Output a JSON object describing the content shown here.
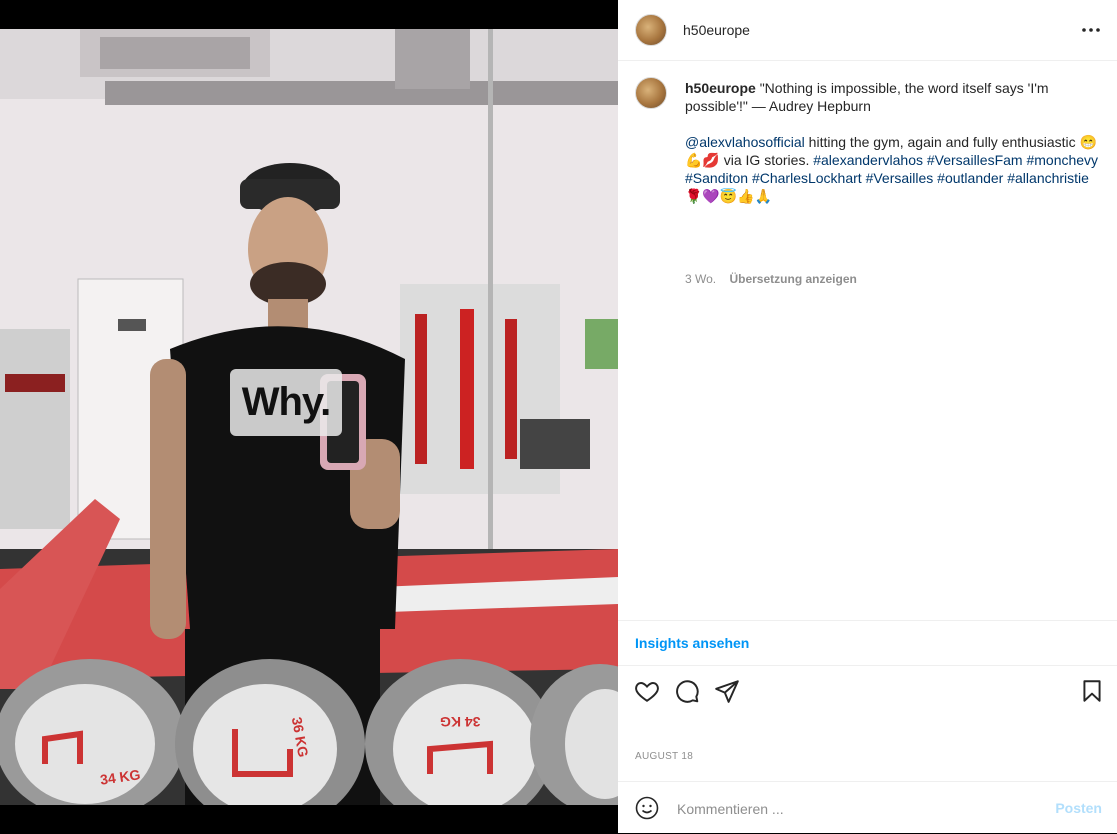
{
  "post": {
    "username": "h50europe",
    "caption_quote": "\"Nothing is impossible, the word itself says 'I'm possible'!\" — Audrey Hepburn",
    "mention": "@alexvlahosofficial",
    "caption_text": " hitting the gym, again and fully enthusiastic 😁💪💋 via IG stories. ",
    "hashtags": [
      "#alexandervlahos",
      "#VersaillesFam",
      "#monchevy",
      "#Sanditon",
      "#CharlesLockhart",
      "#Versailles",
      "#outlander",
      "#allanchristie"
    ],
    "caption_end_emojis": "🌹💜😇👍🙏",
    "age": "3 Wo.",
    "translate_label": "Übersetzung anzeigen",
    "insights_label": "Insights ansehen",
    "date": "AUGUST 18",
    "comment_placeholder": "Kommentieren ...",
    "post_label": "Posten"
  },
  "photo": {
    "sticker_text": "Why.",
    "plate_labels": [
      "34 KG",
      "36 KG",
      "34 KG"
    ]
  },
  "icons": {
    "more": "more-options-icon",
    "like": "heart-icon",
    "comment": "comment-icon",
    "share": "share-icon",
    "save": "bookmark-icon",
    "emoji": "emoji-icon"
  },
  "colors": {
    "link": "#00376b",
    "accent": "#0095f6",
    "muted": "#8e8e8e",
    "post_disabled": "#b2dffc"
  }
}
